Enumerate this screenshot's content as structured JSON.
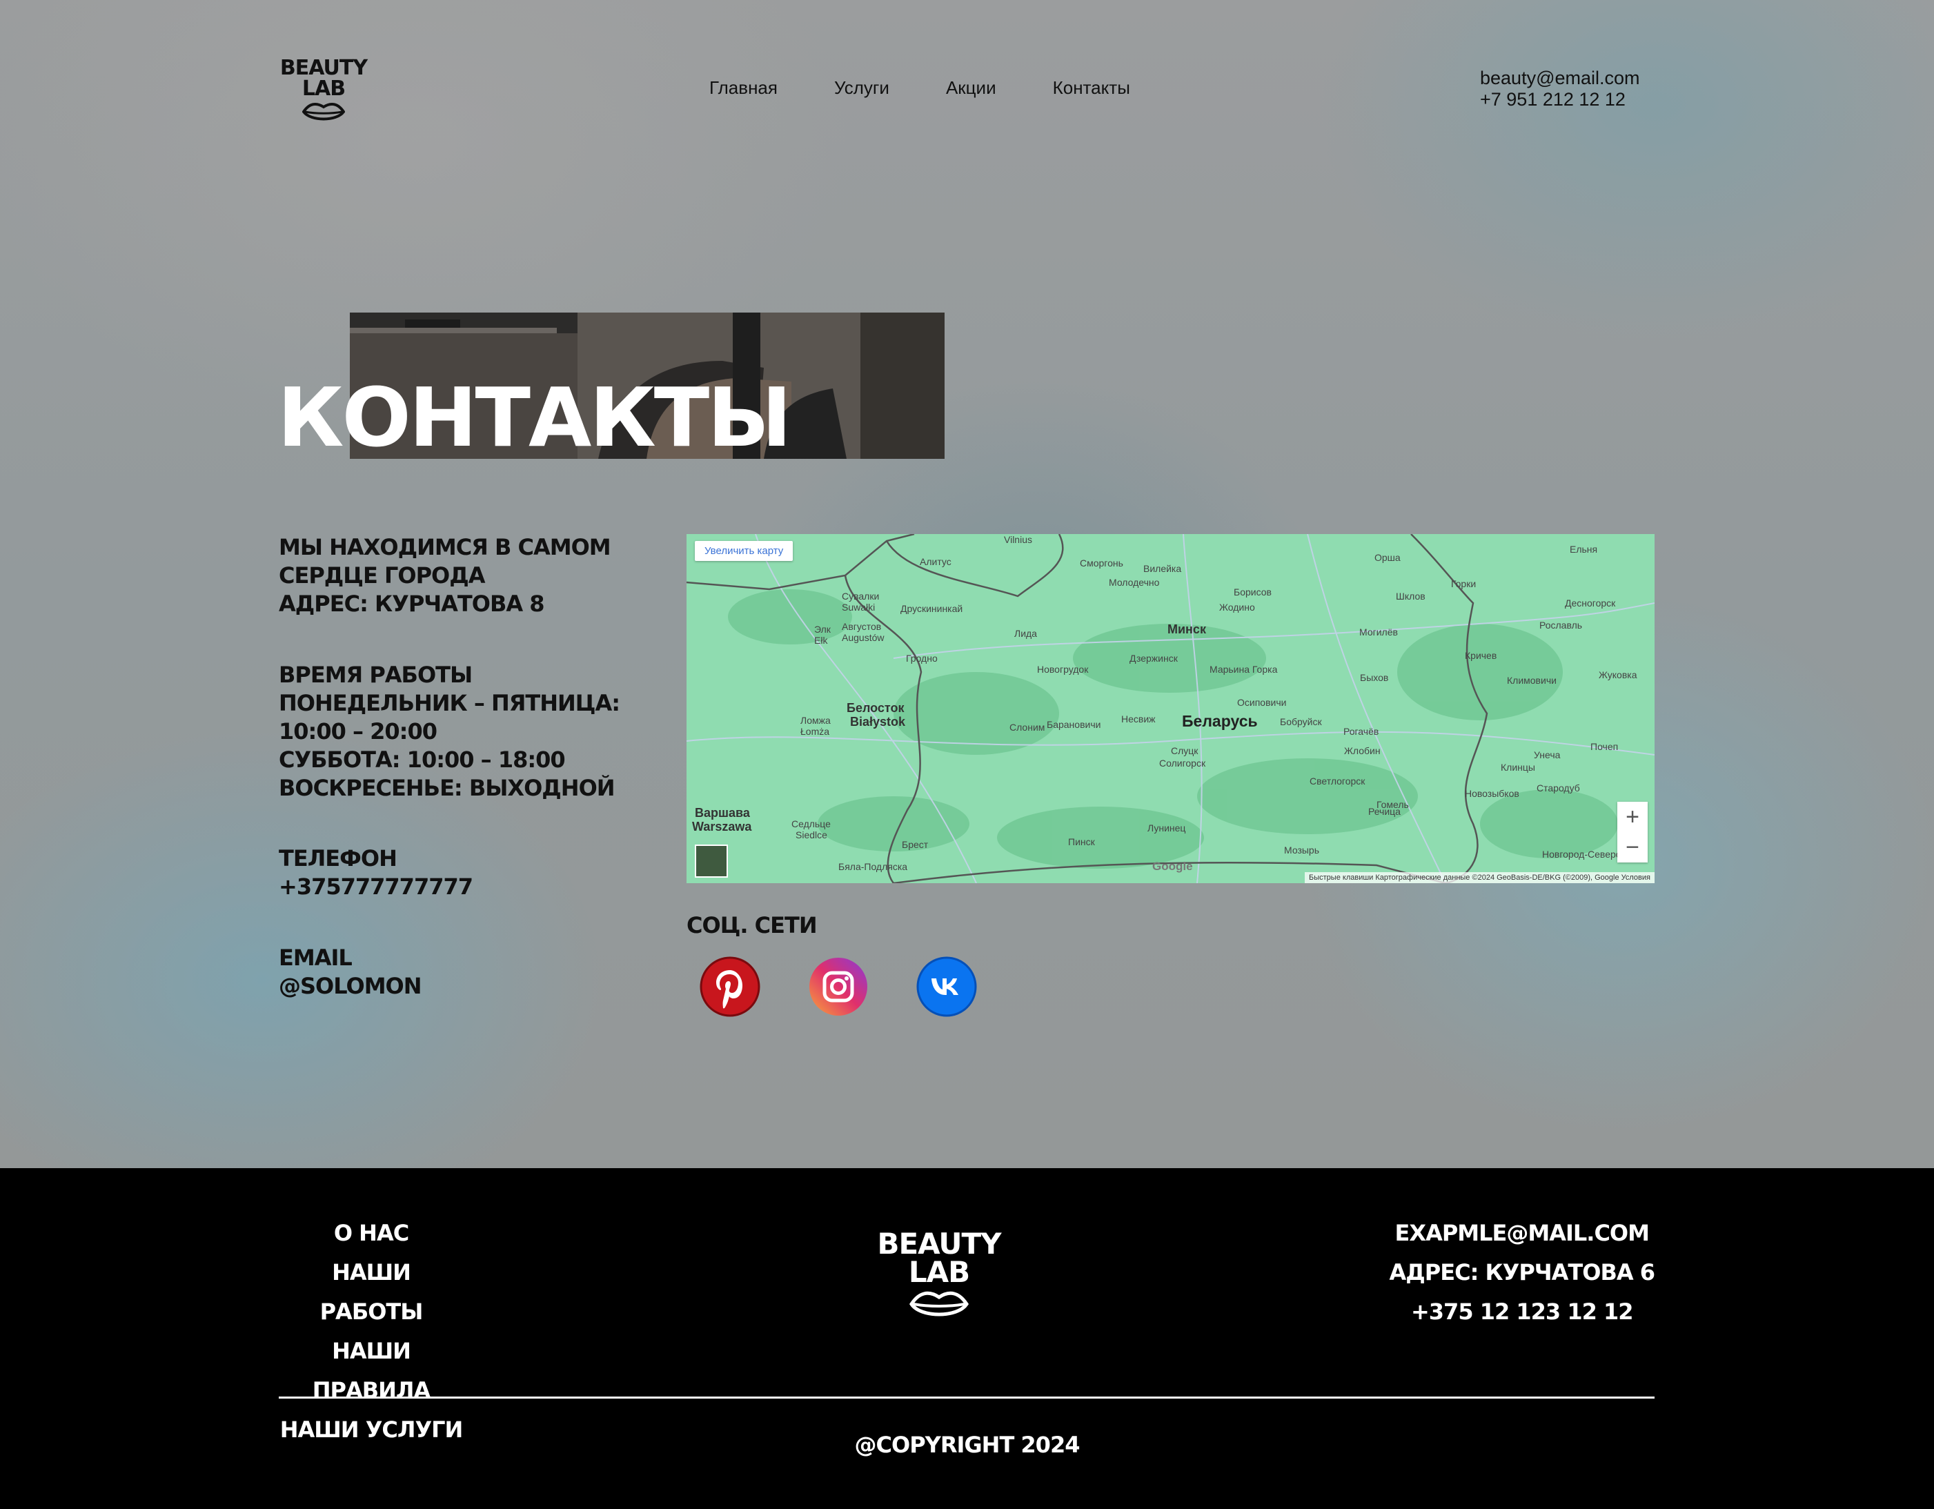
{
  "header": {
    "logo_line1": "BEAUTY",
    "logo_line2": "LAB",
    "nav": [
      "Главная",
      "Услуги",
      "Акции",
      "Контакты"
    ],
    "email": "beauty@email.com",
    "phone": "+7 951 212 12 12"
  },
  "hero": {
    "title": "Контакты"
  },
  "info": {
    "location_line1": "Мы находимся в самом",
    "location_line2": "сердце города",
    "address": "Адрес: Курчатова 8",
    "hours_title": "Время работы",
    "hours_weekdays_label": "Понедельник – пятница:",
    "hours_weekdays_time": "10:00 – 20:00",
    "hours_saturday": "Суббота: 10:00 – 18:00",
    "hours_sunday": "Воскресенье: выходной",
    "phone_title": "Телефон",
    "phone_value": "+375777777777",
    "email_title": "Email",
    "email_value": "@Solomon"
  },
  "map": {
    "enlarge_label": "Увеличить карту",
    "zoom_in": "+",
    "zoom_out": "−",
    "google": "Google",
    "attribution": "Быстрые клавиши   Картографические данные ©2024 GeoBasis-DE/BKG (©2009), Google   Условия",
    "labels": {
      "belarus": "Беларусь",
      "minsk": "Минск",
      "bialystok_ru": "Белосток",
      "bialystok_pl": "Białystok",
      "warsaw_ru": "Варшава",
      "warsaw_pl": "Warszawa",
      "grodno": "Гродно",
      "brest": "Брест",
      "gomel": "Гомель",
      "mogilev": "Могилёв",
      "vilnius": "Vilnius",
      "alytus": "Алитус",
      "lida": "Лида",
      "baranovichi": "Барановичи",
      "slutsk": "Слуцк",
      "soligorsk": "Солигорск",
      "molodechno": "Молодечно",
      "borisov": "Борисов",
      "bobruisk": "Бобруйск",
      "zhlobin": "Жлобин",
      "orsha": "Орша",
      "pinsk": "Пинск",
      "mozyr": "Мозырь",
      "rechitsa": "Речица",
      "svetlogorsk": "Светлогорск",
      "krichev": "Кричев",
      "bykhov": "Быхов",
      "shklov": "Шклов",
      "novogrudok": "Новогрудок",
      "slonim": "Слоним",
      "nesvizh": "Несвиж",
      "dzerzhinsk": "Дзержинск",
      "marina_gorka": "Марьина Горка",
      "zhodino": "Жодино",
      "vileyka": "Вилейка",
      "smorgon": "Сморгонь",
      "osipovichi": "Осиповичи",
      "rogachev": "Рогачёв",
      "luninets": "Лунинец",
      "klimovichi": "Климовичи",
      "siedlce_ru": "Седльце",
      "siedlce_pl": "Siedlce",
      "lomza_ru": "Ломжа",
      "lomza_pl": "Łomża",
      "elk_ru": "Элк",
      "elk_pl": "Ełk",
      "augustow_ru": "Августов",
      "augustow_pl": "Augustów",
      "druskininkai": "Друскининкай",
      "suwalki_ru": "Сувалки",
      "suwalki_pl": "Suwałki",
      "gorki": "Горки",
      "elnya": "Ельня",
      "desnogorsk": "Десногорск",
      "roslavl": "Рославль",
      "zhukovka": "Жуковка",
      "pochep": "Почеп",
      "klintsy": "Клинцы",
      "starodub": "Стародуб",
      "novozybkov": "Новозыбков",
      "unecha": "Унеча",
      "novgorod_seversky": "Новгород-Северский",
      "biala_podlaska": "Бяла-Подляска"
    }
  },
  "social": {
    "title": "Соц. сети",
    "icons": [
      "pinterest-icon",
      "instagram-icon",
      "vk-icon"
    ]
  },
  "footer": {
    "links": [
      "О нас",
      "Наши работы",
      "Наши правила",
      "Наши услуги"
    ],
    "logo_line1": "BEAUTY",
    "logo_line2": "LAB",
    "email": "exapmle@mail.com",
    "address": "Адрес: Курчатова 6",
    "phone": "+375 12 123 12 12",
    "copyright": "@Copyright 2024"
  },
  "colors": {
    "footer_bg": "#000000",
    "map_land": "#8fdcb0",
    "pinterest": "#c8161d",
    "vk": "#0a74f0"
  }
}
